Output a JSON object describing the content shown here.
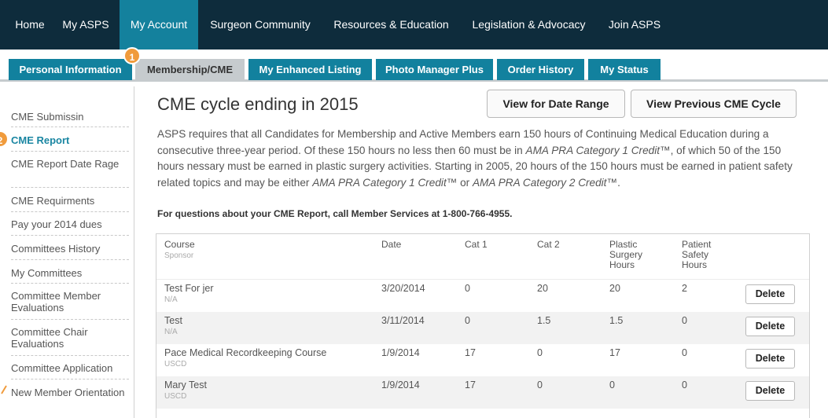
{
  "topnav": {
    "items": [
      "Home",
      "My ASPS",
      "My Account",
      "Surgeon Community",
      "Resources & Education",
      "Legislation & Advocacy",
      "Join ASPS"
    ]
  },
  "tabs": [
    "Personal Information",
    "Membership/CME",
    "My Enhanced Listing",
    "Photo Manager Plus",
    "Order History",
    "My Status"
  ],
  "badges": [
    "1",
    "2"
  ],
  "sidebar": {
    "items": [
      "CME Submissin",
      "CME Report",
      "CME Report Date Rage",
      "CME Requirments",
      "Pay your 2014 dues",
      "Committees History",
      "My Committees",
      "Committee Member Evaluations",
      "Committee Chair Evaluations",
      "Committee Application",
      "New Member Orientation"
    ]
  },
  "main": {
    "title": "CME cycle ending in 2015",
    "btn_date_range": "View for Date Range",
    "btn_previous": "View Previous CME Cycle",
    "para_1": "ASPS requires that all Candidates for Membership and Active Members earn 150 hours of Continuing Medical Education during a consecutive three-year period. Of these 150 hours no less then 60 must be in ",
    "para_ama1": "AMA PRA Category 1 Credit",
    "para_2": "™, of which 50 of the 150 hours nessary must be earned in plastic surgery activities. Starting in 2005, 20 hours of the 150 hours must be earned in patient safety related topics and may be either ",
    "para_ama1b": "AMA PRA Category 1 Credit",
    "para_3": "™ or ",
    "para_ama2": "AMA PRA Category 2 Credit",
    "para_4": "™.",
    "question": "For questions about your CME Report, call Member Services at 1-800-766-4955."
  },
  "table": {
    "headers": {
      "course": "Course",
      "sponsor": "Sponsor",
      "date": "Date",
      "cat1": "Cat 1",
      "cat2": "Cat 2",
      "plastic_1": "Plastic",
      "plastic_2": "Surgery",
      "plastic_3": "Hours",
      "patient_1": "Patient",
      "patient_2": "Safety",
      "patient_3": "Hours"
    },
    "delete_label": "Delete",
    "rows": [
      {
        "course": "Test For jer",
        "sponsor": "N/A",
        "date": "3/20/2014",
        "cat1": "0",
        "cat2": "20",
        "plastic": "20",
        "patient": "2"
      },
      {
        "course": "Test",
        "sponsor": "N/A",
        "date": "3/11/2014",
        "cat1": "0",
        "cat2": "1.5",
        "plastic": "1.5",
        "patient": "0"
      },
      {
        "course": "Pace Medical Recordkeeping Course",
        "sponsor": "USCD",
        "date": "1/9/2014",
        "cat1": "17",
        "cat2": "0",
        "plastic": "17",
        "patient": "0"
      },
      {
        "course": "Mary Test",
        "sponsor": "USCD",
        "date": "1/9/2014",
        "cat1": "17",
        "cat2": "0",
        "plastic": "0",
        "patient": "0"
      }
    ]
  },
  "colors": {
    "nav_bg": "#0e2c3c",
    "accent": "#14819d",
    "badge": "#f09b3c"
  }
}
